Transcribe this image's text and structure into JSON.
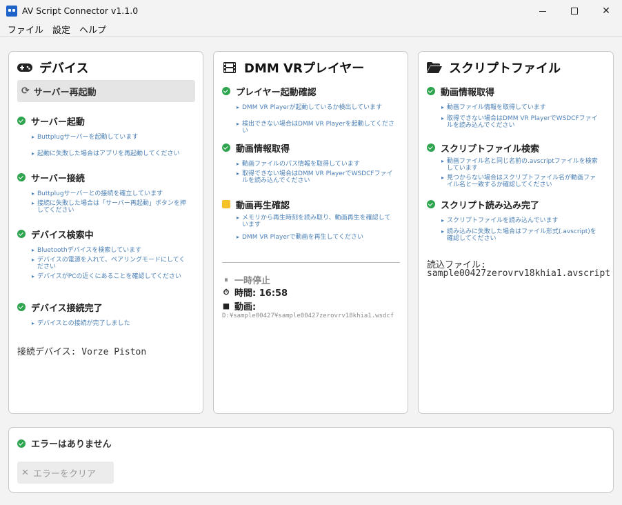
{
  "window": {
    "title": "AV Script Connector v1.1.0",
    "icons": {
      "app": "app-icon",
      "minimize": "minimize-icon",
      "maximize": "maximize-icon",
      "close": "close-icon"
    },
    "close_glyph": "✕"
  },
  "menu": {
    "items": [
      "ファイル",
      "設定",
      "ヘルプ"
    ]
  },
  "device_panel": {
    "title": "デバイス",
    "icon": "gamepad-icon",
    "restart_button": {
      "label": "サーバー再起動",
      "icon": "refresh-icon",
      "glyph": "⟳"
    },
    "steps": [
      {
        "title": "サーバー起動",
        "status": "ok",
        "details": [
          "Buttplugサーバーを起動しています",
          "起動に失敗した場合はアプリを再起動してください"
        ]
      },
      {
        "title": "サーバー接続",
        "status": "ok",
        "details": [
          "Buttplugサーバーとの接続を確立しています",
          "接続に失敗した場合は「サーバー再起動」ボタンを押してください"
        ]
      },
      {
        "title": "デバイス検索中",
        "status": "ok",
        "details": [
          "Bluetoothデバイスを検索しています",
          "デバイスの電源を入れて、ペアリングモードにしてください",
          "デバイスがPCの近くにあることを確認してください"
        ]
      },
      {
        "title": "デバイス接続完了",
        "status": "ok",
        "details": [
          "デバイスとの接続が完了しました"
        ]
      }
    ],
    "connected_device": "接続デバイス: Vorze Piston"
  },
  "player_panel": {
    "title": "DMM VRプレイヤー",
    "icon": "film-icon",
    "steps": [
      {
        "title": "プレイヤー起動確認",
        "status": "ok",
        "details": [
          "DMM VR Playerが起動しているか検出しています",
          "検出できない場合はDMM VR Playerを起動してください"
        ]
      },
      {
        "title": "動画情報取得",
        "status": "ok",
        "details": [
          "動画ファイルのパス情報を取得しています",
          "取得できない場合はDMM VR PlayerでWSDCFファイルを読み込んでください"
        ]
      },
      {
        "title": "動画再生確認",
        "status": "warn",
        "details": [
          "メモリから再生時刻を読み取り、動画再生を確認しています",
          "DMM VR Playerで動画を再生してください"
        ]
      }
    ],
    "playback": {
      "state": "一時停止",
      "state_icon": "pause-icon",
      "state_glyph": "⏸",
      "time_label": "時間: 16:58",
      "time_icon": "stopwatch-icon",
      "time_glyph": "⏱",
      "video_label": "動画:",
      "video_icon": "folder-icon",
      "video_glyph": "■",
      "video_path": "D:¥sample00427¥sample00427zerovrv18khia1.wsdcf"
    }
  },
  "script_panel": {
    "title": "スクリプトファイル",
    "icon": "folder-open-icon",
    "steps": [
      {
        "title": "動画情報取得",
        "status": "ok",
        "details": [
          "動画ファイル情報を取得しています",
          "取得できない場合はDMM VR PlayerでWSDCFファイルを読み込んでください"
        ]
      },
      {
        "title": "スクリプトファイル検索",
        "status": "ok",
        "details": [
          "動画ファイル名と同じ名前の.avscriptファイルを検索しています",
          "見つからない場合はスクリプトファイル名が動画ファイル名と一致するか確認してください"
        ]
      },
      {
        "title": "スクリプト読み込み完了",
        "status": "ok",
        "details": [
          "スクリプトファイルを読み込んでいます",
          "読み込みに失敗した場合はファイル形式(.avscript)を確認してください"
        ]
      }
    ],
    "loaded_label": "読込ファイル:",
    "loaded_file": "sample00427zerovrv18khia1.avscript"
  },
  "error_panel": {
    "status": "エラーはありません",
    "clear_button": {
      "label": "エラーをクリア",
      "icon": "x-icon",
      "glyph": "✕"
    }
  },
  "colors": {
    "ok": "#2ea44f",
    "warn": "#f4c12b",
    "detail": "#4a7fb5"
  }
}
